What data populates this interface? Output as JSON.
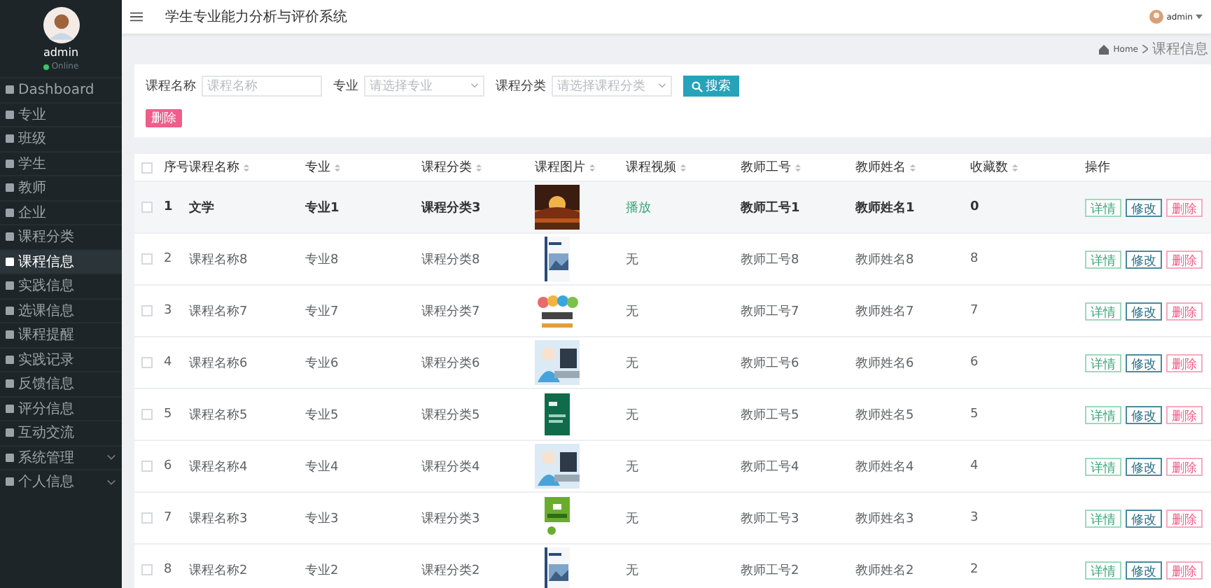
{
  "sidebar": {
    "user": {
      "name": "admin",
      "status": "Online"
    },
    "items": [
      {
        "label": "Dashboard",
        "kind": "link",
        "selected": false
      },
      {
        "label": "专业",
        "kind": "link",
        "selected": false
      },
      {
        "label": "班级",
        "kind": "link",
        "selected": false
      },
      {
        "label": "学生",
        "kind": "link",
        "selected": false
      },
      {
        "label": "教师",
        "kind": "link",
        "selected": false
      },
      {
        "label": "企业",
        "kind": "link",
        "selected": false
      },
      {
        "label": "课程分类",
        "kind": "link",
        "selected": false
      },
      {
        "label": "课程信息",
        "kind": "link",
        "selected": true
      },
      {
        "label": "实践信息",
        "kind": "link",
        "selected": false
      },
      {
        "label": "选课信息",
        "kind": "link",
        "selected": false
      },
      {
        "label": "课程提醒",
        "kind": "link",
        "selected": false
      },
      {
        "label": "实践记录",
        "kind": "link",
        "selected": false
      },
      {
        "label": "反馈信息",
        "kind": "link",
        "selected": false
      },
      {
        "label": "评分信息",
        "kind": "link",
        "selected": false
      },
      {
        "label": "互动交流",
        "kind": "link",
        "selected": false
      },
      {
        "label": "系统管理",
        "kind": "group",
        "selected": false
      },
      {
        "label": "个人信息",
        "kind": "group",
        "selected": false
      }
    ]
  },
  "header": {
    "title": "学生专业能力分析与评价系统",
    "user": "admin"
  },
  "breadcrumb": [
    "Home",
    "课程信息"
  ],
  "search": {
    "fields": [
      {
        "label": "课程名称",
        "placeholder": "课程名称",
        "kind": "input"
      },
      {
        "label": "专业",
        "placeholder": "请选择专业",
        "kind": "select"
      },
      {
        "label": "课程分类",
        "placeholder": "请选择课程分类",
        "kind": "select"
      }
    ],
    "button": "搜索"
  },
  "delete_button": "删除",
  "table": {
    "all_checked": false,
    "columns": [
      "序号",
      "课程名称",
      "专业",
      "课程分类",
      "课程图片",
      "课程视频",
      "教师工号",
      "教师姓名",
      "收藏数",
      "操作"
    ],
    "rows": [
      {
        "checked": false,
        "highlighted": true,
        "cells": [
          "1",
          "文学",
          "专业1",
          "课程分类3",
          "",
          "播放",
          "教师工号1",
          "教师姓名1",
          "0"
        ],
        "actions": [
          "详情",
          "修改",
          "删除"
        ]
      },
      {
        "checked": false,
        "highlighted": false,
        "cells": [
          "2",
          "课程名称8",
          "专业8",
          "课程分类8",
          "",
          "无",
          "教师工号8",
          "教师姓名8",
          "8"
        ],
        "actions": [
          "详情",
          "修改",
          "删除"
        ]
      },
      {
        "checked": false,
        "highlighted": false,
        "cells": [
          "3",
          "课程名称7",
          "专业7",
          "课程分类7",
          "",
          "无",
          "教师工号7",
          "教师姓名7",
          "7"
        ],
        "actions": [
          "详情",
          "修改",
          "删除"
        ]
      },
      {
        "checked": false,
        "highlighted": false,
        "cells": [
          "4",
          "课程名称6",
          "专业6",
          "课程分类6",
          "",
          "无",
          "教师工号6",
          "教师姓名6",
          "6"
        ],
        "actions": [
          "详情",
          "修改",
          "删除"
        ]
      },
      {
        "checked": false,
        "highlighted": false,
        "cells": [
          "5",
          "课程名称5",
          "专业5",
          "课程分类5",
          "",
          "无",
          "教师工号5",
          "教师姓名5",
          "5"
        ],
        "actions": [
          "详情",
          "修改",
          "删除"
        ]
      },
      {
        "checked": false,
        "highlighted": false,
        "cells": [
          "6",
          "课程名称4",
          "专业4",
          "课程分类4",
          "",
          "无",
          "教师工号4",
          "教师姓名4",
          "4"
        ],
        "actions": [
          "详情",
          "修改",
          "删除"
        ]
      },
      {
        "checked": false,
        "highlighted": false,
        "cells": [
          "7",
          "课程名称3",
          "专业3",
          "课程分类3",
          "",
          "无",
          "教师工号3",
          "教师姓名3",
          "3"
        ],
        "actions": [
          "详情",
          "修改",
          "删除"
        ]
      },
      {
        "checked": false,
        "highlighted": false,
        "cells": [
          "8",
          "课程名称2",
          "专业2",
          "课程分类2",
          "",
          "无",
          "教师工号2",
          "教师姓名2",
          "2"
        ],
        "actions": [
          "详情",
          "修改",
          "删除"
        ]
      }
    ]
  }
}
